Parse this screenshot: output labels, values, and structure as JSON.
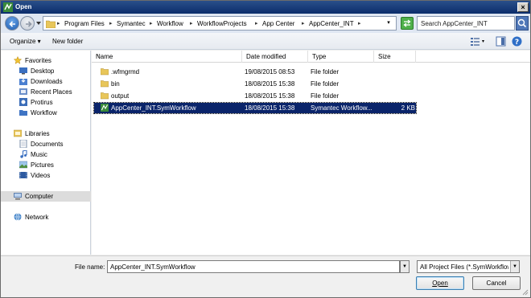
{
  "window": {
    "title": "Open"
  },
  "address": {
    "crumbs": [
      "Program Files",
      "Symantec",
      "Workflow",
      "WorkflowProjects",
      "App Center",
      "AppCenter_INT"
    ],
    "search_placeholder": "Search AppCenter_INT"
  },
  "toolbar": {
    "organize_label": "Organize ▾",
    "new_folder_label": "New folder"
  },
  "nav": {
    "favorites": {
      "label": "Favorites",
      "items": [
        "Desktop",
        "Downloads",
        "Recent Places",
        "Protirus",
        "Workflow"
      ]
    },
    "libraries": {
      "label": "Libraries",
      "items": [
        "Documents",
        "Music",
        "Pictures",
        "Videos"
      ]
    },
    "computer_label": "Computer",
    "network_label": "Network"
  },
  "files": {
    "columns": [
      "Name",
      "Date modified",
      "Type",
      "Size"
    ],
    "sort_indicator": "^",
    "rows": [
      {
        "name": ".wfmgrmd",
        "date": "19/08/2015 08:53",
        "type": "File folder",
        "size": "",
        "icon": "folder-icon"
      },
      {
        "name": "bin",
        "date": "18/08/2015 15:38",
        "type": "File folder",
        "size": "",
        "icon": "folder-icon"
      },
      {
        "name": "output",
        "date": "18/08/2015 15:38",
        "type": "File folder",
        "size": "",
        "icon": "folder-icon"
      },
      {
        "name": "AppCenter_INT.SymWorkflow",
        "date": "18/08/2015 15:38",
        "type": "Symantec Workflow...",
        "size": "2 KB",
        "icon": "symworkflow-file-icon",
        "selected": true
      }
    ]
  },
  "bottom": {
    "filename_label": "File name:",
    "filename_value": "AppCenter_INT.SymWorkflow",
    "filter_value": "All Project Files (*.SymWorkflow",
    "open_label": "Open",
    "cancel_label": "Cancel"
  },
  "colors": {
    "selection": "#0a246a",
    "titlebar": "#0b2d6b",
    "folder": "#e8c65a"
  }
}
